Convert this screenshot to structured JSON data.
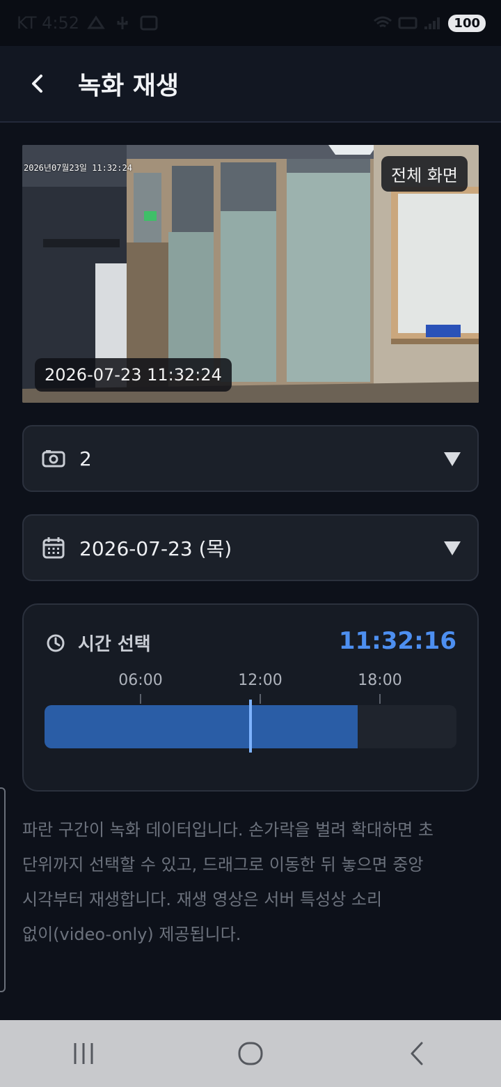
{
  "status_bar": {
    "carrier_time": "KT 4:52",
    "battery": "100"
  },
  "appbar": {
    "title": "녹화 재생"
  },
  "video": {
    "osd_text": "2026년07월23일  11:32:24",
    "fullscreen_label": "전체 화면",
    "timestamp": "2026-07-23 11:32:24"
  },
  "camera_selector": {
    "value": "2"
  },
  "date_selector": {
    "value": "2026-07-23 (목)"
  },
  "time_select": {
    "title": "시간 선택",
    "current_time": "11:32:16",
    "ticks": [
      "06:00",
      "12:00",
      "18:00"
    ],
    "recorded_fraction": 0.76,
    "playhead_fraction": 0.5
  },
  "help_text": {
    "line1": "파란 구간이 녹화 데이터입니다. 손가락을 벌려 확대하면 초",
    "line2": "단위까지 선택할 수 있고, 드래그로 이동한 뒤 놓으면 중앙",
    "line3": "시각부터 재생합니다. 재생 영상은 서버 특성상 소리",
    "line4": "없이(video-only) 제공됩니다."
  },
  "colors": {
    "accent": "#4d8ff0",
    "recorded_bar": "#2a5da6",
    "background": "#0d111a"
  },
  "icons": {
    "back": "chevron-left-icon",
    "camera": "camera-icon",
    "calendar": "calendar-icon",
    "clock": "clock-icon",
    "dropdown": "triangle-down-icon"
  }
}
